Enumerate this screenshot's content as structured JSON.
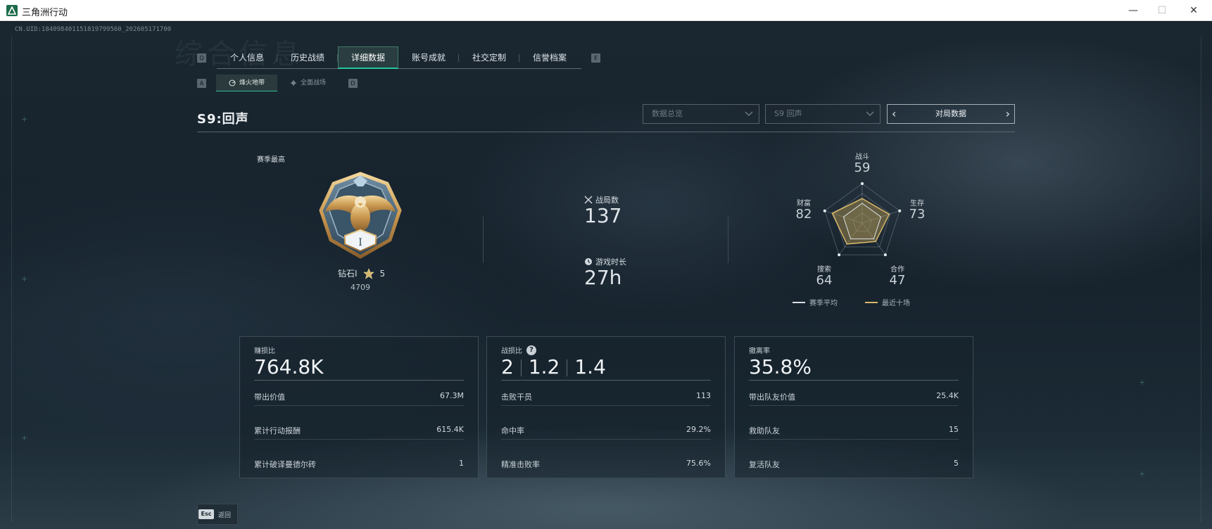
{
  "window": {
    "title": "三角洲行动",
    "minimize": "—",
    "maximize": "☐",
    "close": "✕"
  },
  "uid": "CN.UID:18409840115181979956​0_202605171700",
  "background_title": "综合信息",
  "tabs": [
    {
      "label": "个人信息",
      "active": false
    },
    {
      "label": "历史战绩",
      "active": false
    },
    {
      "label": "详细数据",
      "active": true
    },
    {
      "label": "账号成就",
      "active": false
    },
    {
      "label": "社交定制",
      "active": false
    },
    {
      "label": "信誉档案",
      "active": false
    }
  ],
  "tab_keys": {
    "left": "Q",
    "right": "E"
  },
  "subtabs": [
    {
      "label": "烽火地带",
      "active": true,
      "icon": "radar-icon"
    },
    {
      "label": "全面战场",
      "active": false,
      "icon": "crosshair-icon"
    }
  ],
  "subtab_keys": {
    "left": "A",
    "right": "D"
  },
  "season": {
    "title": "S9:回声"
  },
  "filters": {
    "mode": "数据总览",
    "season": "S9 回声",
    "match_nav_label": "对局数据"
  },
  "rank": {
    "heading": "赛季最高",
    "name": "钻石I",
    "stars": "5",
    "score": "4709",
    "badge_numeral": "I"
  },
  "matches": {
    "count_label": "战局数",
    "count_value": "137",
    "time_label": "游戏时长",
    "time_value": "27h"
  },
  "radar": {
    "axes": [
      {
        "label": "战斗",
        "value": "59"
      },
      {
        "label": "生存",
        "value": "73"
      },
      {
        "label": "合作",
        "value": "47"
      },
      {
        "label": "搜索",
        "value": "64"
      },
      {
        "label": "财富",
        "value": "82"
      }
    ],
    "season_avg": [
      0.5,
      0.5,
      0.5,
      0.5,
      0.5
    ],
    "recent": [
      0.62,
      0.72,
      0.58,
      0.66,
      0.8
    ],
    "legend_avg": "赛季平均",
    "legend_recent": "最近十场",
    "colors": {
      "avg": "#d9dfe3",
      "recent": "#d8b86a"
    }
  },
  "cards": {
    "profit": {
      "label": "赚损比",
      "big": "764.8K",
      "rows": [
        {
          "k": "带出价值",
          "v": "67.3M"
        },
        {
          "k": "累计行动报酬",
          "v": "615.4K"
        },
        {
          "k": "累计破译曼德尔砖",
          "v": "1"
        }
      ]
    },
    "kd": {
      "label": "战损比",
      "help": "?",
      "values": [
        "2",
        "1.2",
        "1.4"
      ],
      "rows": [
        {
          "k": "击败干员",
          "v": "113"
        },
        {
          "k": "命中率",
          "v": "29.2%"
        },
        {
          "k": "精准击败率",
          "v": "75.6%"
        }
      ]
    },
    "extract": {
      "label": "撤离率",
      "big": "35.8%",
      "rows": [
        {
          "k": "带出队友价值",
          "v": "25.4K"
        },
        {
          "k": "救助队友",
          "v": "15"
        },
        {
          "k": "复活队友",
          "v": "5"
        }
      ]
    }
  },
  "footer": {
    "esc_key": "Esc",
    "back_label": "返回"
  }
}
